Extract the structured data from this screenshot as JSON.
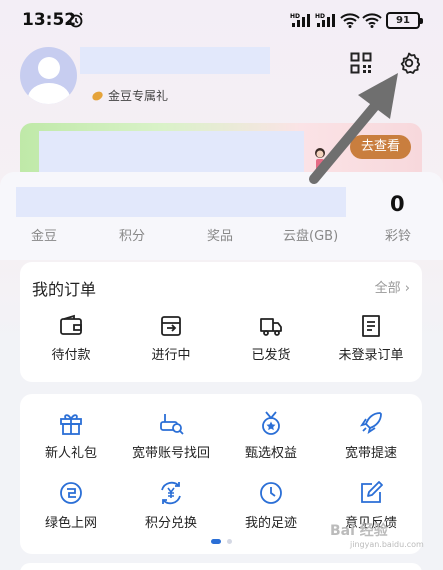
{
  "status": {
    "time": "13:52",
    "battery": "91"
  },
  "profile": {
    "bean_tag": "金豆专属礼"
  },
  "banner": {
    "button": "去查看"
  },
  "stats": {
    "value": "0",
    "labels": [
      "金豆",
      "积分",
      "奖品",
      "云盘(GB)",
      "彩铃"
    ]
  },
  "orders": {
    "title": "我的订单",
    "all": "全部 ›",
    "items": [
      "待付款",
      "进行中",
      "已发货",
      "未登录订单"
    ]
  },
  "services": {
    "row1": [
      "新人礼包",
      "宽带账号找回",
      "甄选权益",
      "宽带提速"
    ],
    "row2": [
      "绿色上网",
      "积分兑换",
      "我的足迹",
      "意见反馈"
    ]
  },
  "watermark": {
    "main": "Bai 经验",
    "sub": "jingyan.baidu.com"
  },
  "colors": {
    "accent": "#2b6fd6",
    "go_button": "#c97e3e"
  }
}
